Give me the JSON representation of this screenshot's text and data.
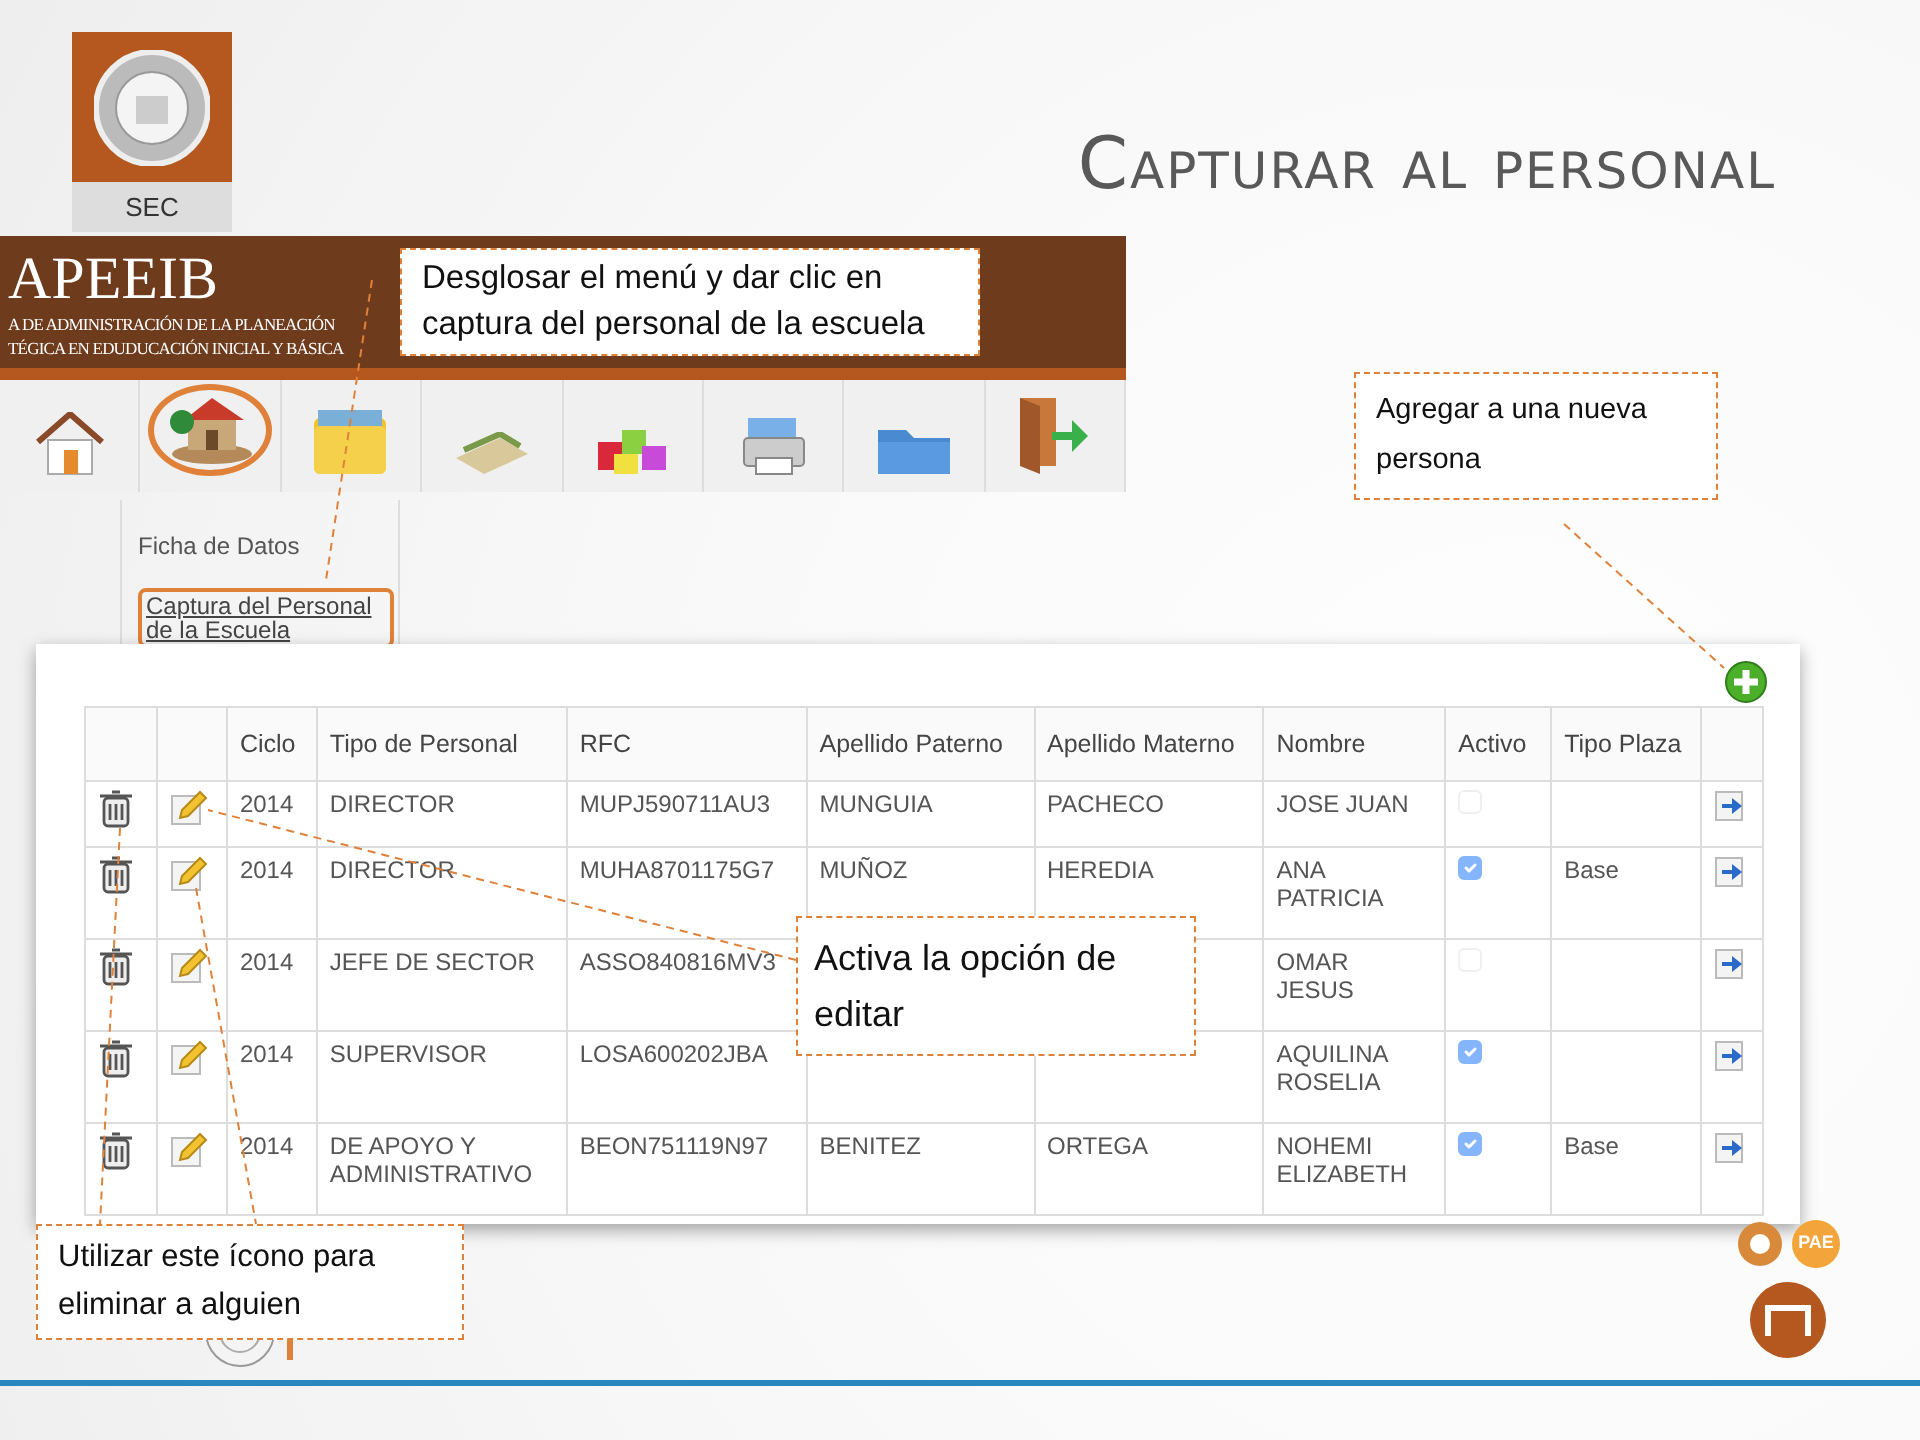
{
  "slide": {
    "title": "Capturar al personal",
    "logo_label": "SEC"
  },
  "app_header": {
    "title": "APEEIB",
    "subtitle_lines": [
      "A DE ADMINISTRACIÓN DE LA PLANEACIÓN",
      "TÉGICA EN EDUDUCACIÓN INICIAL Y BÁSICA"
    ]
  },
  "toolbar": {
    "items": [
      {
        "kind": "home",
        "selected": false
      },
      {
        "kind": "school",
        "selected": true
      },
      {
        "kind": "folder",
        "selected": false
      },
      {
        "kind": "books",
        "selected": false
      },
      {
        "kind": "blocks",
        "selected": false
      },
      {
        "kind": "printer",
        "selected": false
      },
      {
        "kind": "archive",
        "selected": false
      },
      {
        "kind": "exit",
        "selected": false
      }
    ]
  },
  "menu": {
    "items": [
      {
        "kind": "text",
        "label": "Ficha de Datos",
        "selected": false
      },
      {
        "kind": "link",
        "label": "Captura del Personal de la Escuela",
        "selected": true
      }
    ]
  },
  "table": {
    "columns": [
      "Ciclo",
      "Tipo de Personal",
      "RFC",
      "Apellido Paterno",
      "Apellido Materno",
      "Nombre",
      "Activo",
      "Tipo Plaza"
    ],
    "rows": [
      {
        "ciclo": "2014",
        "tipo": "DIRECTOR",
        "rfc": "MUPJ590711AU3",
        "apellido_paterno": "MUNGUIA",
        "apellido_materno": "PACHECO",
        "nombre": "JOSE JUAN",
        "activo": false
      },
      {
        "ciclo": "2014",
        "tipo": "DIRECTOR",
        "rfc": "MUHA8701175G7",
        "apellido_paterno": "MUÑOZ",
        "apellido_materno": "HEREDIA",
        "nombre": "ANA PATRICIA",
        "activo": true,
        "tipo_plaza": "Base"
      },
      {
        "ciclo": "2014",
        "tipo": "JEFE DE SECTOR",
        "rfc": "ASSO840816MV3",
        "nombre": "OMAR JESUS",
        "activo": false
      },
      {
        "ciclo": "2014",
        "tipo": "SUPERVISOR",
        "rfc": "LOSA600202JBA",
        "nombre": "AQUILINA ROSELIA",
        "activo": true
      },
      {
        "ciclo": "2014",
        "tipo": "DE APOYO Y ADMINISTRATIVO",
        "rfc": "BEON751119N97",
        "apellido_paterno": "BENITEZ",
        "apellido_materno": "ORTEGA",
        "nombre": "NOHEMI ELIZABETH",
        "activo": true,
        "tipo_plaza": "Base"
      }
    ]
  },
  "callouts": [
    {
      "text": "Desglosar el menú y dar clic en captura del personal de la escuela"
    },
    {
      "text": "Agregar a una nueva persona"
    },
    {
      "text": "Activa la opción de editar"
    },
    {
      "text": "Utilizar este ícono para eliminar a alguien"
    }
  ],
  "footer": {
    "badge": "PAE"
  }
}
